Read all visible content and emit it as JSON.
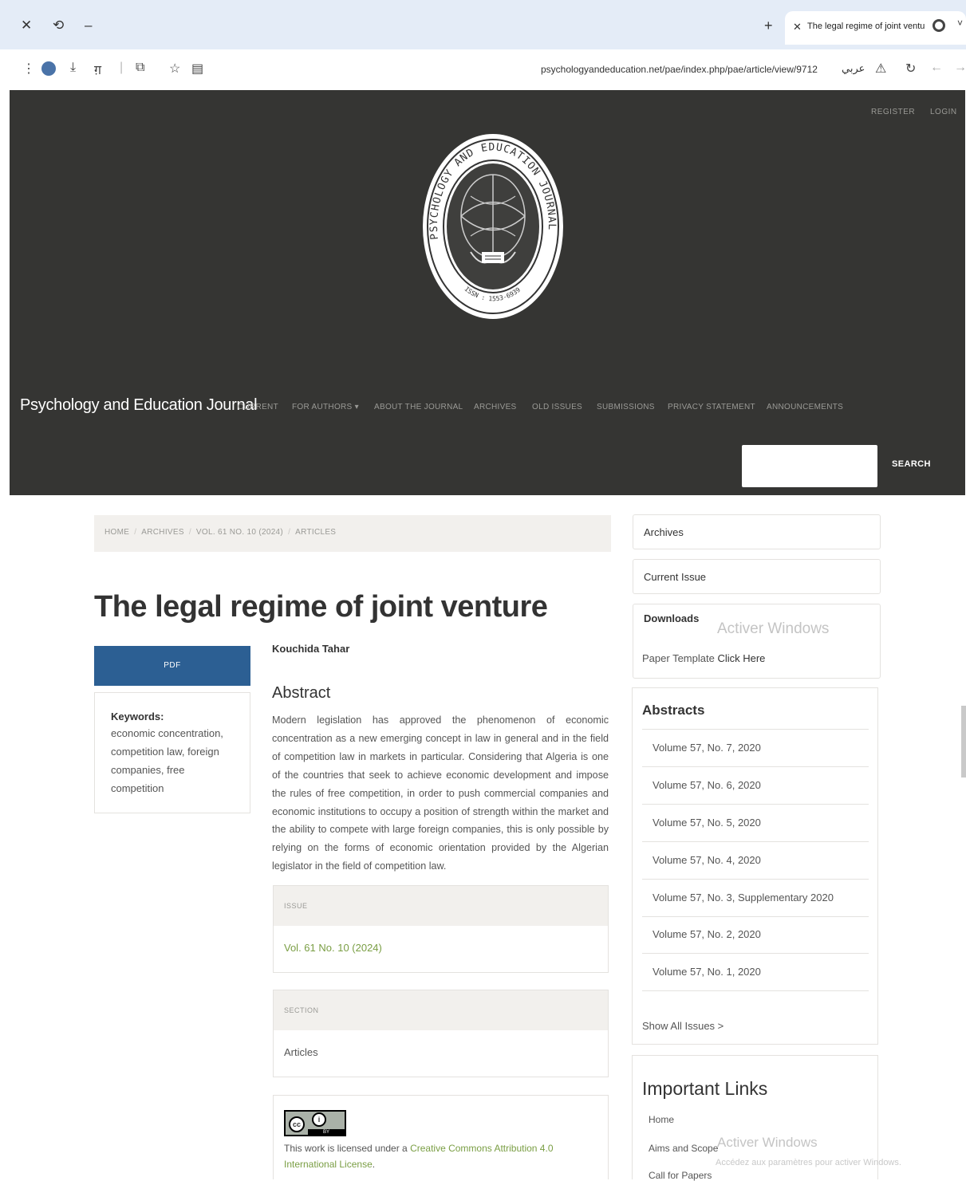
{
  "browser": {
    "tab_title": "The legal regime of joint ventu",
    "new_tab": "+",
    "url": "psychologyandeducation.net/pae/index.php/pae/article/view/9712",
    "translate_label": "عربي"
  },
  "header": {
    "register": "REGISTER",
    "login": "LOGIN",
    "logo_text": "PSYCHOLOGY AND EDUCATION JOURNAL",
    "logo_issn": "ISSN : 1553-6939",
    "site_title": "Psychology and Education Journal",
    "nav": [
      "CURRENT",
      "FOR AUTHORS ▾",
      "ABOUT THE JOURNAL",
      "ARCHIVES",
      "OLD ISSUES",
      "SUBMISSIONS",
      "PRIVACY STATEMENT",
      "ANNOUNCEMENTS"
    ],
    "search_button": "SEARCH"
  },
  "breadcrumb": [
    "HOME",
    "ARCHIVES",
    "VOL. 61 NO. 10 (2024)",
    "ARTICLES"
  ],
  "article": {
    "title": "The legal regime of joint venture",
    "pdf_label": "PDF",
    "keywords_label": "Keywords:",
    "keywords": "economic concentration, competition law, foreign companies, free competition",
    "author": "Kouchida Tahar",
    "abstract_heading": "Abstract",
    "abstract": "Modern legislation has approved the phenomenon of economic concentration as a new emerging concept in law in general and in the field of competition law in markets in particular. Considering that Algeria is one of the countries that seek to achieve economic development and impose the rules of free competition, in order to push commercial companies and economic institutions to occupy a position of strength within the market and the ability to compete with large foreign companies, this is only possible by relying on the forms of economic orientation provided by the Algerian legislator in the field of competition law.",
    "issue_label": "ISSUE",
    "issue_value": "Vol. 61 No. 10 (2024)",
    "section_label": "SECTION",
    "section_value": "Articles",
    "license_prefix": "This work is licensed under a ",
    "license_link": "Creative Commons Attribution 4.0 International License",
    "license_suffix": "."
  },
  "sidebar": {
    "archives": "Archives",
    "current_issue": "Current Issue",
    "downloads_title": "Downloads",
    "paper_template_prefix": "Paper Template ",
    "paper_template_link": "Click Here",
    "abstracts_title": "Abstracts",
    "abstracts": [
      "Volume 57, No. 7, 2020",
      "Volume 57, No. 6, 2020",
      "Volume 57, No. 5, 2020",
      "Volume 57, No. 4, 2020",
      "Volume 57, No. 3, Supplementary 2020",
      "Volume 57, No. 2, 2020",
      "Volume 57, No. 1, 2020"
    ],
    "show_all": "Show All Issues >",
    "important_links_title": "Important Links",
    "important_links": [
      "Home",
      "Aims and Scope",
      "Call for Papers"
    ]
  },
  "watermark": {
    "line1": "Activer Windows",
    "line2": "Accédez aux paramètres pour activer Windows."
  },
  "colors": {
    "header_bg": "#353533",
    "pdf_button": "#2c5f93",
    "link_green": "#7a9e44",
    "tab_strip": "#e4ecf7"
  }
}
